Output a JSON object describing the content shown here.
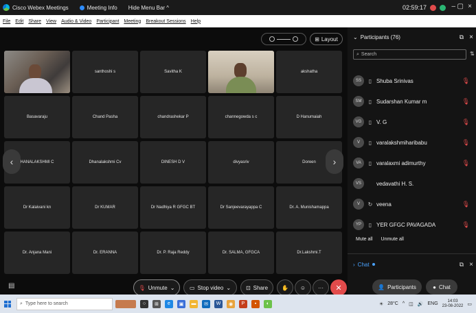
{
  "titlebar": {
    "app_name": "Cisco Webex Meetings",
    "meeting_info": "Meeting Info",
    "hide_menu": "Hide Menu Bar ^",
    "clock": "02:59:17",
    "minimize": "–",
    "maximize": "▢",
    "close": "×"
  },
  "menubar": {
    "items": [
      "File",
      "Edit",
      "Share",
      "View",
      "Audio & Video",
      "Participant",
      "Meeting",
      "Breakout Sessions",
      "Help"
    ]
  },
  "stage": {
    "layout_label": "Layout",
    "tiles": [
      {
        "name": "",
        "video": true
      },
      {
        "name": "santhoshi s"
      },
      {
        "name": "Savitha K"
      },
      {
        "name": "",
        "video": true
      },
      {
        "name": "akshatha"
      },
      {
        "name": "Basavaraju"
      },
      {
        "name": "Chand Pasha"
      },
      {
        "name": "chandrashekar P"
      },
      {
        "name": "channegowda s c"
      },
      {
        "name": "D Hanumaiah"
      },
      {
        "name": "HANALAKSHMI C"
      },
      {
        "name": "Dhanalakshmi Cv"
      },
      {
        "name": "DINESH D V"
      },
      {
        "name": "divyasriv"
      },
      {
        "name": "Doreen"
      },
      {
        "name": "Dr Kalaivani kn"
      },
      {
        "name": "Dr KUMAR"
      },
      {
        "name": "Dr Nadhiya R GFGC BT"
      },
      {
        "name": "Dr Sanjeevarayappa C"
      },
      {
        "name": "Dr. A. Munishamappa"
      },
      {
        "name": "Dr. Anjana Mani"
      },
      {
        "name": "Dr. ERANNA"
      },
      {
        "name": "Dr. P. Raja Reddy"
      },
      {
        "name": "Dr. SALMA, GFGCA"
      },
      {
        "name": "Dr.Lakshmi.T"
      }
    ]
  },
  "controls": {
    "unmute": "Unmute",
    "stop_video": "Stop video",
    "share": "Share"
  },
  "participants": {
    "title": "Participants (76)",
    "search_placeholder": "Search",
    "list": [
      {
        "initials": "SS",
        "name": "Shuba Srinivas"
      },
      {
        "initials": "SM",
        "name": "Sudarshan Kumar m"
      },
      {
        "initials": "VG",
        "name": "V. G"
      },
      {
        "initials": "V",
        "name": "varalakshmiharibabu"
      },
      {
        "initials": "VA",
        "name": "varalaxmi adimurthy"
      },
      {
        "initials": "VS",
        "name": "vedavathi H. S."
      },
      {
        "initials": "V",
        "name": "veena"
      },
      {
        "initials": "YP",
        "name": "YER GFGC PAVAGADA"
      }
    ],
    "mute_all": "Mute all",
    "unmute_all": "Unmute all"
  },
  "chat": {
    "title": "Chat"
  },
  "bottom_pills": {
    "participants": "Participants",
    "chat": "Chat"
  },
  "taskbar": {
    "search_placeholder": "Type here to search",
    "temp": "28°C",
    "lang": "ENG",
    "time": "14:03",
    "date": "23-08-2022"
  },
  "colors": {
    "accent_red": "#e24b4b",
    "accent_blue": "#4aa3ff"
  }
}
